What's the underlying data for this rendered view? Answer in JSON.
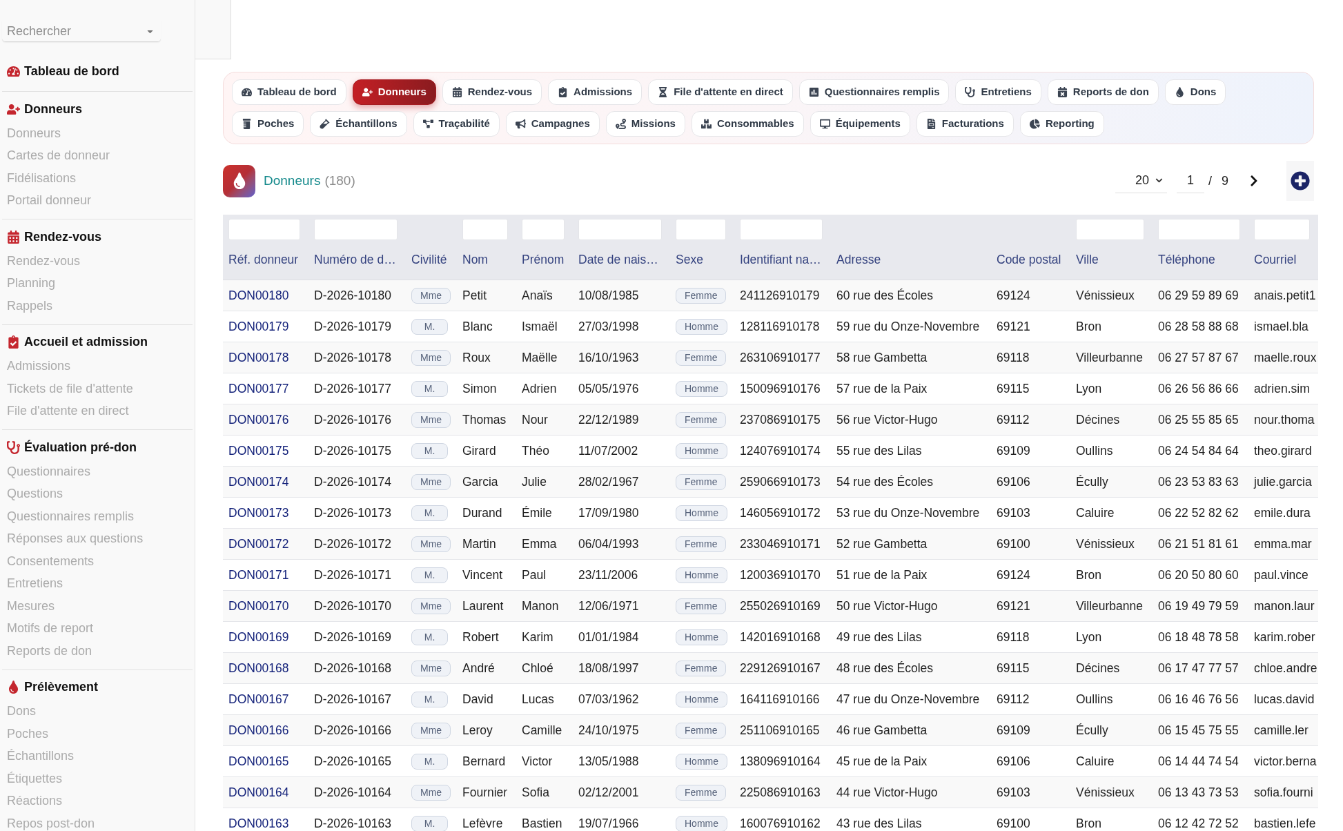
{
  "sidebar": {
    "search": {
      "placeholder": "Rechercher"
    },
    "sections": [
      {
        "title": "Tableau de bord"
      },
      {
        "title": "Donneurs",
        "items": [
          "Donneurs",
          "Cartes de donneur",
          "Fidélisations",
          "Portail donneur"
        ]
      },
      {
        "title": "Rendez-vous",
        "items": [
          "Rendez-vous",
          "Planning",
          "Rappels"
        ]
      },
      {
        "title": "Accueil et admission",
        "items": [
          "Admissions",
          "Tickets de file d'attente",
          "File d'attente en direct"
        ]
      },
      {
        "title": "Évaluation pré-don",
        "items": [
          "Questionnaires",
          "Questions",
          "Questionnaires remplis",
          "Réponses aux questions",
          "Consentements",
          "Entretiens",
          "Mesures",
          "Motifs de report",
          "Reports de don"
        ]
      },
      {
        "title": "Prélèvement",
        "items": [
          "Dons",
          "Poches",
          "Échantillons",
          "Étiquettes",
          "Réactions",
          "Repos post-don"
        ]
      }
    ]
  },
  "tab_rows": [
    [
      {
        "label": "Tableau de bord",
        "selected": false
      },
      {
        "label": "Donneurs",
        "selected": true
      },
      {
        "label": "Rendez-vous",
        "selected": false
      },
      {
        "label": "Admissions",
        "selected": false
      },
      {
        "label": "File d'attente en direct",
        "selected": false
      },
      {
        "label": "Questionnaires remplis",
        "selected": false
      },
      {
        "label": "Entretiens",
        "selected": false
      },
      {
        "label": "Reports de don",
        "selected": false
      },
      {
        "label": "Dons",
        "selected": false
      }
    ],
    [
      {
        "label": "Poches",
        "selected": false
      },
      {
        "label": "Échantillons",
        "selected": false
      },
      {
        "label": "Traçabilité",
        "selected": false
      },
      {
        "label": "Campagnes",
        "selected": false
      },
      {
        "label": "Missions",
        "selected": false
      },
      {
        "label": "Consommables",
        "selected": false
      },
      {
        "label": "Équipements",
        "selected": false
      },
      {
        "label": "Facturations",
        "selected": false
      },
      {
        "label": "Reporting",
        "selected": false
      }
    ]
  ],
  "header": {
    "title": "Donneurs",
    "count": "(180)",
    "page_size": "20",
    "page": "1",
    "separator": "/",
    "page_count": "9"
  },
  "table": {
    "columns": [
      {
        "label": "Réf. donneur",
        "kind": "link",
        "filter": true
      },
      {
        "label": "Numéro de d…",
        "kind": "text",
        "filter": true
      },
      {
        "label": "Civilité",
        "kind": "badge",
        "filter": false
      },
      {
        "label": "Nom",
        "kind": "text",
        "filter": true
      },
      {
        "label": "Prénom",
        "kind": "text",
        "filter": true
      },
      {
        "label": "Date de nais…",
        "kind": "text",
        "filter": true
      },
      {
        "label": "Sexe",
        "kind": "badge",
        "filter": true
      },
      {
        "label": "Identifiant na…",
        "kind": "text",
        "filter": true
      },
      {
        "label": "Adresse",
        "kind": "text",
        "filter": false
      },
      {
        "label": "Code postal",
        "kind": "text",
        "filter": false
      },
      {
        "label": "Ville",
        "kind": "text",
        "filter": true
      },
      {
        "label": "Téléphone",
        "kind": "text",
        "filter": true
      },
      {
        "label": "Courriel",
        "kind": "text",
        "filter": true
      }
    ],
    "rows": [
      [
        "DON00180",
        "D-2026-10180",
        "Mme",
        "Petit",
        "Anaïs",
        "10/08/1985",
        "Femme",
        "241126910179",
        "60 rue des Écoles",
        "69124",
        "Vénissieux",
        "06 29 59 89 69",
        "anais.petit1"
      ],
      [
        "DON00179",
        "D-2026-10179",
        "M.",
        "Blanc",
        "Ismaël",
        "27/03/1998",
        "Homme",
        "128116910178",
        "59 rue du Onze-Novembre",
        "69121",
        "Bron",
        "06 28 58 88 68",
        "ismael.bla"
      ],
      [
        "DON00178",
        "D-2026-10178",
        "Mme",
        "Roux",
        "Maëlle",
        "16/10/1963",
        "Femme",
        "263106910177",
        "58 rue Gambetta",
        "69118",
        "Villeurbanne",
        "06 27 57 87 67",
        "maelle.roux"
      ],
      [
        "DON00177",
        "D-2026-10177",
        "M.",
        "Simon",
        "Adrien",
        "05/05/1976",
        "Homme",
        "150096910176",
        "57 rue de la Paix",
        "69115",
        "Lyon",
        "06 26 56 86 66",
        "adrien.sim"
      ],
      [
        "DON00176",
        "D-2026-10176",
        "Mme",
        "Thomas",
        "Nour",
        "22/12/1989",
        "Femme",
        "237086910175",
        "56 rue Victor-Hugo",
        "69112",
        "Décines",
        "06 25 55 85 65",
        "nour.thoma"
      ],
      [
        "DON00175",
        "D-2026-10175",
        "M.",
        "Girard",
        "Théo",
        "11/07/2002",
        "Homme",
        "124076910174",
        "55 rue des Lilas",
        "69109",
        "Oullins",
        "06 24 54 84 64",
        "theo.girard"
      ],
      [
        "DON00174",
        "D-2026-10174",
        "Mme",
        "Garcia",
        "Julie",
        "28/02/1967",
        "Femme",
        "259066910173",
        "54 rue des Écoles",
        "69106",
        "Écully",
        "06 23 53 83 63",
        "julie.garcia"
      ],
      [
        "DON00173",
        "D-2026-10173",
        "M.",
        "Durand",
        "Émile",
        "17/09/1980",
        "Homme",
        "146056910172",
        "53 rue du Onze-Novembre",
        "69103",
        "Caluire",
        "06 22 52 82 62",
        "emile.dura"
      ],
      [
        "DON00172",
        "D-2026-10172",
        "Mme",
        "Martin",
        "Emma",
        "06/04/1993",
        "Femme",
        "233046910171",
        "52 rue Gambetta",
        "69100",
        "Vénissieux",
        "06 21 51 81 61",
        "emma.mar"
      ],
      [
        "DON00171",
        "D-2026-10171",
        "M.",
        "Vincent",
        "Paul",
        "23/11/2006",
        "Homme",
        "120036910170",
        "51 rue de la Paix",
        "69124",
        "Bron",
        "06 20 50 80 60",
        "paul.vince"
      ],
      [
        "DON00170",
        "D-2026-10170",
        "Mme",
        "Laurent",
        "Manon",
        "12/06/1971",
        "Femme",
        "255026910169",
        "50 rue Victor-Hugo",
        "69121",
        "Villeurbanne",
        "06 19 49 79 59",
        "manon.laur"
      ],
      [
        "DON00169",
        "D-2026-10169",
        "M.",
        "Robert",
        "Karim",
        "01/01/1984",
        "Homme",
        "142016910168",
        "49 rue des Lilas",
        "69118",
        "Lyon",
        "06 18 48 78 58",
        "karim.rober"
      ],
      [
        "DON00168",
        "D-2026-10168",
        "Mme",
        "André",
        "Chloé",
        "18/08/1997",
        "Femme",
        "229126910167",
        "48 rue des Écoles",
        "69115",
        "Décines",
        "06 17 47 77 57",
        "chloe.andre"
      ],
      [
        "DON00167",
        "D-2026-10167",
        "M.",
        "David",
        "Lucas",
        "07/03/1962",
        "Homme",
        "164116910166",
        "47 rue du Onze-Novembre",
        "69112",
        "Oullins",
        "06 16 46 76 56",
        "lucas.david"
      ],
      [
        "DON00166",
        "D-2026-10166",
        "Mme",
        "Leroy",
        "Camille",
        "24/10/1975",
        "Femme",
        "251106910165",
        "46 rue Gambetta",
        "69109",
        "Écully",
        "06 15 45 75 55",
        "camille.ler"
      ],
      [
        "DON00165",
        "D-2026-10165",
        "M.",
        "Bernard",
        "Victor",
        "13/05/1988",
        "Homme",
        "138096910164",
        "45 rue de la Paix",
        "69106",
        "Caluire",
        "06 14 44 74 54",
        "victor.berna"
      ],
      [
        "DON00164",
        "D-2026-10164",
        "Mme",
        "Fournier",
        "Sofia",
        "02/12/2001",
        "Femme",
        "225086910163",
        "44 rue Victor-Hugo",
        "69103",
        "Vénissieux",
        "06 13 43 73 53",
        "sofia.fourni"
      ],
      [
        "DON00163",
        "D-2026-10163",
        "M.",
        "Lefèvre",
        "Bastien",
        "19/07/1966",
        "Homme",
        "160076910162",
        "43 rue des Lilas",
        "69100",
        "Bron",
        "06 12 42 72 52",
        "bastien.lefe"
      ]
    ]
  }
}
